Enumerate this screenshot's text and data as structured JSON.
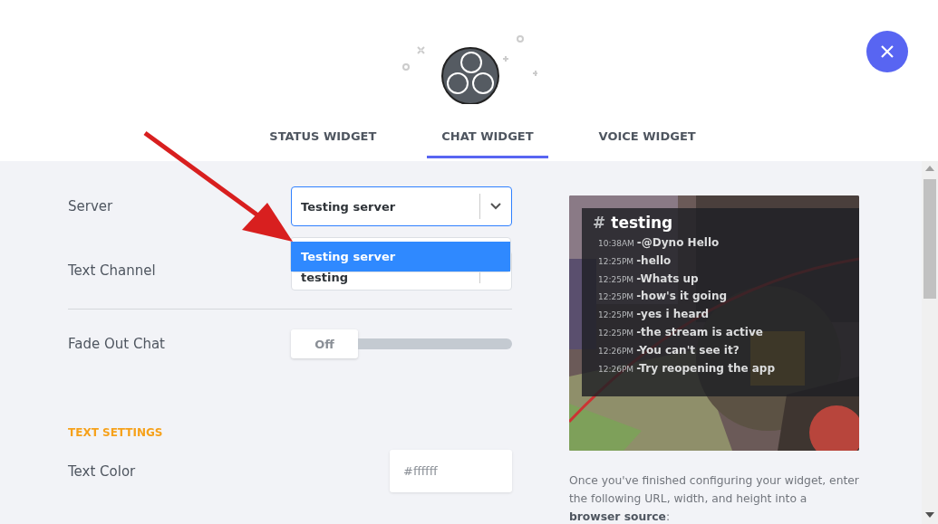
{
  "tabs": [
    {
      "label": "STATUS WIDGET",
      "selected": false
    },
    {
      "label": "CHAT WIDGET",
      "selected": true
    },
    {
      "label": "VOICE WIDGET",
      "selected": false
    }
  ],
  "server": {
    "label": "Server",
    "value": "Testing server",
    "options": [
      {
        "label": "Testing server",
        "selected": true
      }
    ]
  },
  "text_channel": {
    "label": "Text Channel",
    "value": "testing"
  },
  "fade_out": {
    "label": "Fade Out Chat",
    "state": "Off",
    "on": false
  },
  "section_title": "TEXT SETTINGS",
  "text_color": {
    "label": "Text Color",
    "placeholder": "#ffffff"
  },
  "preview": {
    "channel_hash": "#",
    "channel": "testing",
    "messages": [
      {
        "time": "10:38AM",
        "text": "-@Dyno Hello"
      },
      {
        "time": "12:25PM",
        "text": "-hello"
      },
      {
        "time": "12:25PM",
        "text": "-Whats up"
      },
      {
        "time": "12:25PM",
        "text": "-how's it going"
      },
      {
        "time": "12:25PM",
        "text": "-yes i heard"
      },
      {
        "time": "12:25PM",
        "text": "-the stream is active"
      },
      {
        "time": "12:26PM",
        "text": "-You can't see it?"
      },
      {
        "time": "12:26PM",
        "text": "-Try reopening the app"
      }
    ]
  },
  "instructions": "Once you've finished configuring your widget, enter the following URL, width, and height into a **browser source**:"
}
